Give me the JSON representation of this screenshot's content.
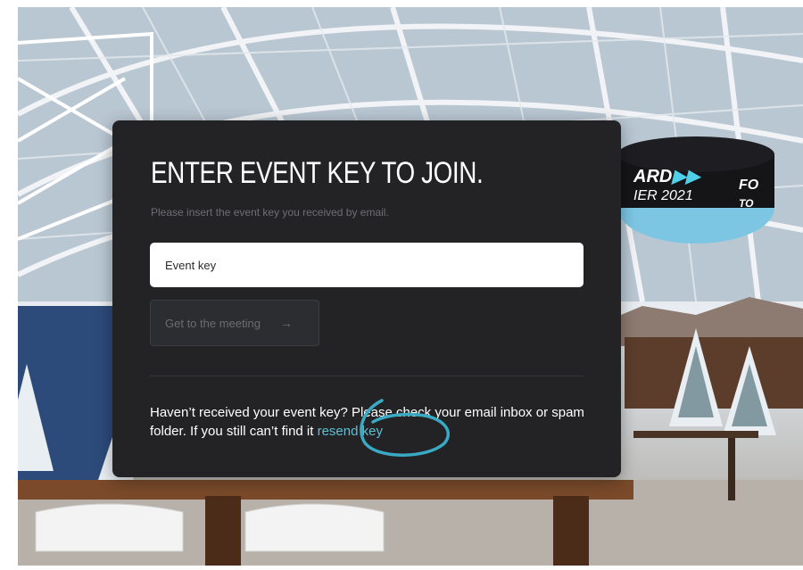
{
  "dialog": {
    "title": "ENTER EVENT KEY TO JOIN.",
    "subtitle": "Please insert the event key you received by email.",
    "input_placeholder": "Event key",
    "join_button_label": "Get to the meeting",
    "join_button_arrow": "→",
    "help_text": "Haven’t received your event key? Please check your email inbox or spam folder. If you still can’t find it",
    "resend_link": "resend key"
  },
  "background_sign": {
    "line1": "ARD",
    "line2": "IER 2021",
    "right_line1": "FO",
    "right_line2": "TO"
  },
  "colors": {
    "dialog_bg": "#232326",
    "link": "#5fc0d2",
    "annotation_circle": "#3aa9c4"
  }
}
